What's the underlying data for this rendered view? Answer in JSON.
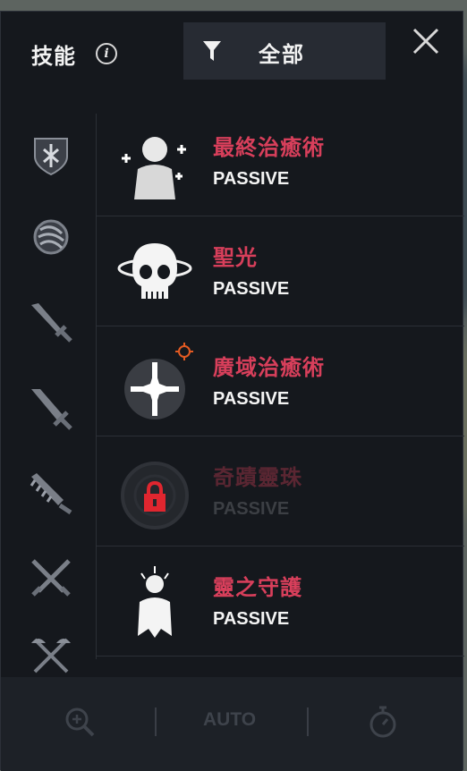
{
  "header": {
    "title": "技能",
    "info_icon": "info-icon",
    "filter_label": "全部",
    "filter_icon": "filter-funnel-icon",
    "close_icon": "close-icon"
  },
  "sidebar": {
    "categories": [
      {
        "icon": "shield-emblem-icon"
      },
      {
        "icon": "gauntlet-fist-icon"
      },
      {
        "icon": "sword-icon"
      },
      {
        "icon": "greatsword-icon"
      },
      {
        "icon": "spiked-blade-icon"
      },
      {
        "icon": "crossed-swords-icon"
      },
      {
        "icon": "crossed-axes-icon"
      }
    ]
  },
  "skills": [
    {
      "name": "最終治癒術",
      "type": "PASSIVE",
      "icon": "healing-figure-icon",
      "locked": false
    },
    {
      "name": "聖光",
      "type": "PASSIVE",
      "icon": "halo-skull-icon",
      "locked": false
    },
    {
      "name": "廣域治癒術",
      "type": "PASSIVE",
      "icon": "radiant-cross-icon",
      "locked": false
    },
    {
      "name": "奇蹟靈珠",
      "type": "PASSIVE",
      "icon": "miracle-orb-icon",
      "locked": true,
      "lock_icon": "lock-icon"
    },
    {
      "name": "靈之守護",
      "type": "PASSIVE",
      "icon": "spirit-guardian-icon",
      "locked": false
    }
  ],
  "footer": {
    "zoom_icon": "magnify-plus-icon",
    "auto_label": "AUTO",
    "timer_icon": "stopwatch-icon"
  },
  "colors": {
    "panel_bg": "#15181d",
    "skill_name": "#d83f5b",
    "skill_type": "#f4f4f4",
    "lock_red": "#e0262f"
  }
}
